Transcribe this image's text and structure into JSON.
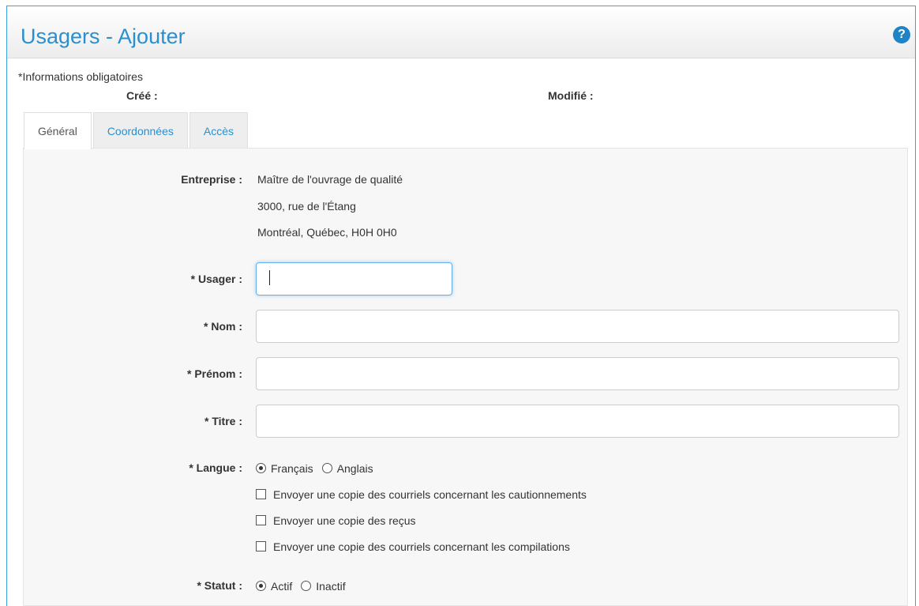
{
  "header": {
    "title": "Usagers - Ajouter",
    "help_icon": "?"
  },
  "meta": {
    "required_note": "*Informations obligatoires",
    "created_label": "Créé :",
    "modified_label": "Modifié :"
  },
  "tabs": [
    {
      "label": "Général",
      "active": true
    },
    {
      "label": "Coordonnées",
      "active": false
    },
    {
      "label": "Accès",
      "active": false
    }
  ],
  "form": {
    "company": {
      "label": "Entreprise :",
      "line1": "Maître de l'ouvrage de qualité",
      "line2": "3000, rue de l'Étang",
      "line3": "Montréal, Québec, H0H 0H0"
    },
    "username": {
      "label": "* Usager :",
      "value": ""
    },
    "last_name": {
      "label": "* Nom :",
      "value": ""
    },
    "first_name": {
      "label": "* Prénom :",
      "value": ""
    },
    "title": {
      "label": "* Titre :",
      "value": ""
    },
    "language": {
      "label": "* Langue :",
      "options": [
        "Français",
        "Anglais"
      ],
      "selected": "Français"
    },
    "checkboxes": [
      {
        "label": "Envoyer une copie des courriels concernant les cautionnements",
        "checked": false
      },
      {
        "label": "Envoyer une copie des reçus",
        "checked": false
      },
      {
        "label": "Envoyer une copie des courriels concernant les compilations",
        "checked": false
      }
    ],
    "status": {
      "label": "* Statut :",
      "options": [
        "Actif",
        "Inactif"
      ],
      "selected": "Actif"
    }
  },
  "colors": {
    "accent": "#2a8fcf",
    "border": "#39a3dd",
    "panel_bg": "#f7f7f7"
  }
}
